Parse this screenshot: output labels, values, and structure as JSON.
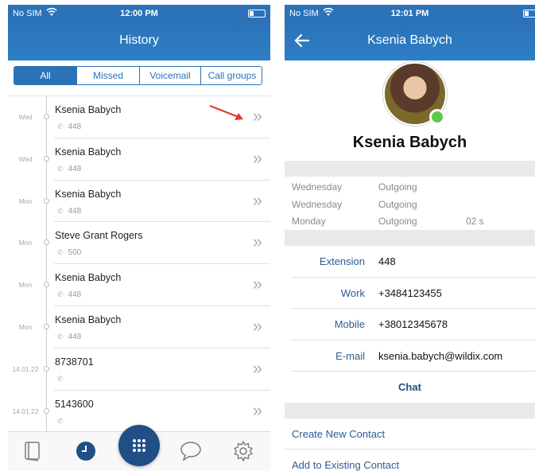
{
  "left": {
    "status": {
      "carrier": "No SIM",
      "time": "12:00 PM"
    },
    "title": "History",
    "tabs": [
      "All",
      "Missed",
      "Voicemail",
      "Call groups"
    ],
    "rows": [
      {
        "day": "Wed",
        "name": "Ksenia Babych",
        "ext": "448"
      },
      {
        "day": "Wed",
        "name": "Ksenia Babych",
        "ext": "448"
      },
      {
        "day": "Mon",
        "name": "Ksenia Babych",
        "ext": "448"
      },
      {
        "day": "Mon",
        "name": "Steve Grant Rogers",
        "ext": "500"
      },
      {
        "day": "Mon",
        "name": "Ksenia Babych",
        "ext": "448"
      },
      {
        "day": "Mon",
        "name": "Ksenia Babych",
        "ext": "448"
      },
      {
        "day": "14.01.22",
        "name": "8738701",
        "ext": ""
      },
      {
        "day": "14.01.22",
        "name": "5143600",
        "ext": ""
      }
    ],
    "bottom_tabs": [
      "book-icon",
      "clock-icon",
      "keypad-icon",
      "chat-bubble-icon",
      "gear-icon"
    ],
    "colors": {
      "brand": "#2b72b8",
      "fab": "#1f4f85",
      "annotation": "#e03a2e"
    }
  },
  "right": {
    "status": {
      "carrier": "No SIM",
      "time": "12:01 PM"
    },
    "title": "Ksenia Babych",
    "name": "Ksenia Babych",
    "calls": [
      {
        "day": "Wednesday",
        "type": "Outgoing",
        "length": ""
      },
      {
        "day": "Wednesday",
        "type": "Outgoing",
        "length": ""
      },
      {
        "day": "Monday",
        "type": "Outgoing",
        "length": "02 s"
      }
    ],
    "fields": [
      {
        "label": "Extension",
        "value": "448"
      },
      {
        "label": "Work",
        "value": "+3484123455"
      },
      {
        "label": "Mobile",
        "value": "+38012345678"
      },
      {
        "label": "E-mail",
        "value": "ksenia.babych@wildix.com"
      }
    ],
    "chat_label": "Chat",
    "create_contact": "Create New Contact",
    "add_existing": "Add to Existing Contact",
    "presence_color": "#5cc94a"
  }
}
